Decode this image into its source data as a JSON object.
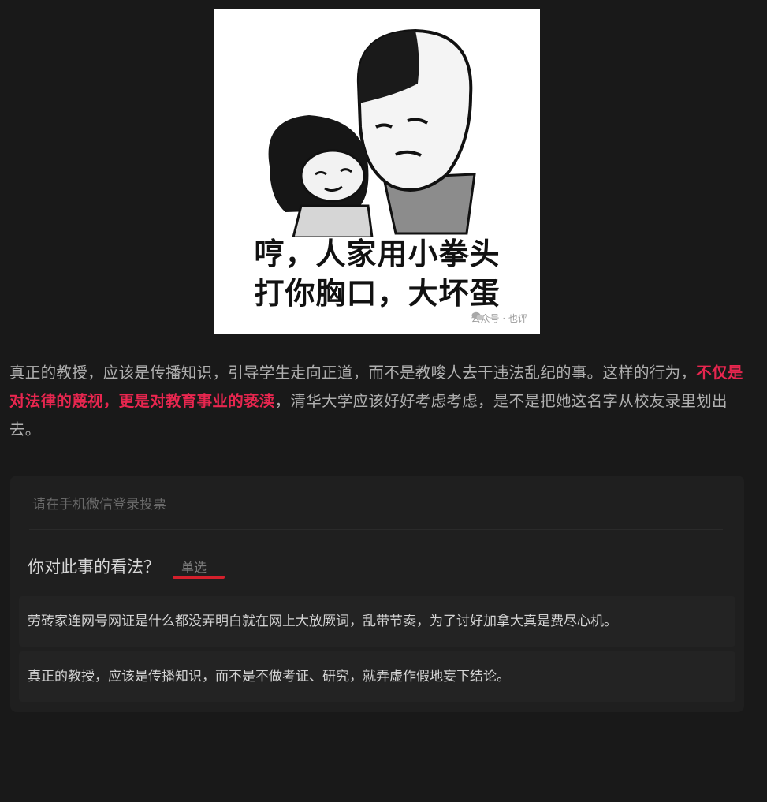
{
  "meme": {
    "caption_line1": "哼，人家用小拳头",
    "caption_line2": "打你胸口，大坏蛋",
    "watermark": "公众号 · 也评"
  },
  "article": {
    "text_before": "真正的教授，应该是传播知识，引导学生走向正道，而不是教唆人去干违法乱纪的事。这样的行为，",
    "highlight": "不仅是对法律的蔑视，更是对教育事业的亵渎",
    "text_after": "，清华大学应该好好考虑考虑，是不是把她这名字从校友录里划出去。",
    "highlight_color": "#e8264f"
  },
  "vote": {
    "hint": "请在手机微信登录投票",
    "question": "你对此事的看法？",
    "type_label": "单选",
    "accent_color": "#d4202c",
    "options": [
      "劳砖家连网号网证是什么都没弄明白就在网上大放厥词，乱带节奏，为了讨好加拿大真是费尽心机。",
      "真正的教授，应该是传播知识，而不是不做考证、研究，就弄虚作假地妄下结论。"
    ]
  }
}
